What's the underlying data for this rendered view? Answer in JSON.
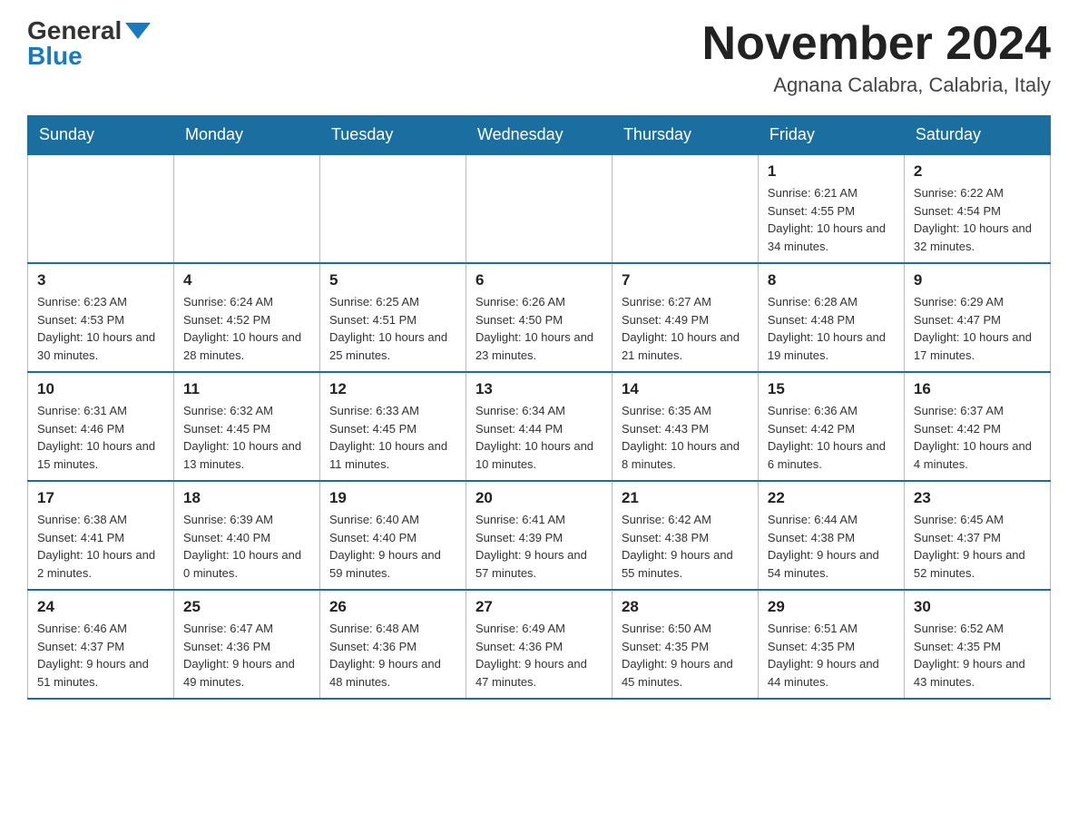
{
  "logo": {
    "general": "General",
    "blue": "Blue"
  },
  "title": "November 2024",
  "location": "Agnana Calabra, Calabria, Italy",
  "headers": [
    "Sunday",
    "Monday",
    "Tuesday",
    "Wednesday",
    "Thursday",
    "Friday",
    "Saturday"
  ],
  "weeks": [
    [
      {
        "day": "",
        "sunrise": "",
        "sunset": "",
        "daylight": ""
      },
      {
        "day": "",
        "sunrise": "",
        "sunset": "",
        "daylight": ""
      },
      {
        "day": "",
        "sunrise": "",
        "sunset": "",
        "daylight": ""
      },
      {
        "day": "",
        "sunrise": "",
        "sunset": "",
        "daylight": ""
      },
      {
        "day": "",
        "sunrise": "",
        "sunset": "",
        "daylight": ""
      },
      {
        "day": "1",
        "sunrise": "Sunrise: 6:21 AM",
        "sunset": "Sunset: 4:55 PM",
        "daylight": "Daylight: 10 hours and 34 minutes."
      },
      {
        "day": "2",
        "sunrise": "Sunrise: 6:22 AM",
        "sunset": "Sunset: 4:54 PM",
        "daylight": "Daylight: 10 hours and 32 minutes."
      }
    ],
    [
      {
        "day": "3",
        "sunrise": "Sunrise: 6:23 AM",
        "sunset": "Sunset: 4:53 PM",
        "daylight": "Daylight: 10 hours and 30 minutes."
      },
      {
        "day": "4",
        "sunrise": "Sunrise: 6:24 AM",
        "sunset": "Sunset: 4:52 PM",
        "daylight": "Daylight: 10 hours and 28 minutes."
      },
      {
        "day": "5",
        "sunrise": "Sunrise: 6:25 AM",
        "sunset": "Sunset: 4:51 PM",
        "daylight": "Daylight: 10 hours and 25 minutes."
      },
      {
        "day": "6",
        "sunrise": "Sunrise: 6:26 AM",
        "sunset": "Sunset: 4:50 PM",
        "daylight": "Daylight: 10 hours and 23 minutes."
      },
      {
        "day": "7",
        "sunrise": "Sunrise: 6:27 AM",
        "sunset": "Sunset: 4:49 PM",
        "daylight": "Daylight: 10 hours and 21 minutes."
      },
      {
        "day": "8",
        "sunrise": "Sunrise: 6:28 AM",
        "sunset": "Sunset: 4:48 PM",
        "daylight": "Daylight: 10 hours and 19 minutes."
      },
      {
        "day": "9",
        "sunrise": "Sunrise: 6:29 AM",
        "sunset": "Sunset: 4:47 PM",
        "daylight": "Daylight: 10 hours and 17 minutes."
      }
    ],
    [
      {
        "day": "10",
        "sunrise": "Sunrise: 6:31 AM",
        "sunset": "Sunset: 4:46 PM",
        "daylight": "Daylight: 10 hours and 15 minutes."
      },
      {
        "day": "11",
        "sunrise": "Sunrise: 6:32 AM",
        "sunset": "Sunset: 4:45 PM",
        "daylight": "Daylight: 10 hours and 13 minutes."
      },
      {
        "day": "12",
        "sunrise": "Sunrise: 6:33 AM",
        "sunset": "Sunset: 4:45 PM",
        "daylight": "Daylight: 10 hours and 11 minutes."
      },
      {
        "day": "13",
        "sunrise": "Sunrise: 6:34 AM",
        "sunset": "Sunset: 4:44 PM",
        "daylight": "Daylight: 10 hours and 10 minutes."
      },
      {
        "day": "14",
        "sunrise": "Sunrise: 6:35 AM",
        "sunset": "Sunset: 4:43 PM",
        "daylight": "Daylight: 10 hours and 8 minutes."
      },
      {
        "day": "15",
        "sunrise": "Sunrise: 6:36 AM",
        "sunset": "Sunset: 4:42 PM",
        "daylight": "Daylight: 10 hours and 6 minutes."
      },
      {
        "day": "16",
        "sunrise": "Sunrise: 6:37 AM",
        "sunset": "Sunset: 4:42 PM",
        "daylight": "Daylight: 10 hours and 4 minutes."
      }
    ],
    [
      {
        "day": "17",
        "sunrise": "Sunrise: 6:38 AM",
        "sunset": "Sunset: 4:41 PM",
        "daylight": "Daylight: 10 hours and 2 minutes."
      },
      {
        "day": "18",
        "sunrise": "Sunrise: 6:39 AM",
        "sunset": "Sunset: 4:40 PM",
        "daylight": "Daylight: 10 hours and 0 minutes."
      },
      {
        "day": "19",
        "sunrise": "Sunrise: 6:40 AM",
        "sunset": "Sunset: 4:40 PM",
        "daylight": "Daylight: 9 hours and 59 minutes."
      },
      {
        "day": "20",
        "sunrise": "Sunrise: 6:41 AM",
        "sunset": "Sunset: 4:39 PM",
        "daylight": "Daylight: 9 hours and 57 minutes."
      },
      {
        "day": "21",
        "sunrise": "Sunrise: 6:42 AM",
        "sunset": "Sunset: 4:38 PM",
        "daylight": "Daylight: 9 hours and 55 minutes."
      },
      {
        "day": "22",
        "sunrise": "Sunrise: 6:44 AM",
        "sunset": "Sunset: 4:38 PM",
        "daylight": "Daylight: 9 hours and 54 minutes."
      },
      {
        "day": "23",
        "sunrise": "Sunrise: 6:45 AM",
        "sunset": "Sunset: 4:37 PM",
        "daylight": "Daylight: 9 hours and 52 minutes."
      }
    ],
    [
      {
        "day": "24",
        "sunrise": "Sunrise: 6:46 AM",
        "sunset": "Sunset: 4:37 PM",
        "daylight": "Daylight: 9 hours and 51 minutes."
      },
      {
        "day": "25",
        "sunrise": "Sunrise: 6:47 AM",
        "sunset": "Sunset: 4:36 PM",
        "daylight": "Daylight: 9 hours and 49 minutes."
      },
      {
        "day": "26",
        "sunrise": "Sunrise: 6:48 AM",
        "sunset": "Sunset: 4:36 PM",
        "daylight": "Daylight: 9 hours and 48 minutes."
      },
      {
        "day": "27",
        "sunrise": "Sunrise: 6:49 AM",
        "sunset": "Sunset: 4:36 PM",
        "daylight": "Daylight: 9 hours and 47 minutes."
      },
      {
        "day": "28",
        "sunrise": "Sunrise: 6:50 AM",
        "sunset": "Sunset: 4:35 PM",
        "daylight": "Daylight: 9 hours and 45 minutes."
      },
      {
        "day": "29",
        "sunrise": "Sunrise: 6:51 AM",
        "sunset": "Sunset: 4:35 PM",
        "daylight": "Daylight: 9 hours and 44 minutes."
      },
      {
        "day": "30",
        "sunrise": "Sunrise: 6:52 AM",
        "sunset": "Sunset: 4:35 PM",
        "daylight": "Daylight: 9 hours and 43 minutes."
      }
    ]
  ]
}
